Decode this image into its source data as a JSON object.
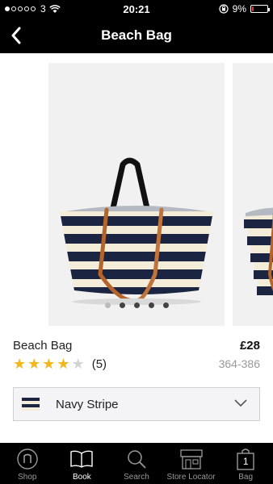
{
  "status_bar": {
    "carrier": "3",
    "time": "20:21",
    "battery": "9%",
    "battery_level": 0.09
  },
  "nav": {
    "title": "Beach Bag"
  },
  "gallery": {
    "page_count": 5,
    "current_page": 1
  },
  "product": {
    "name": "Beach Bag",
    "price": "£28",
    "rating": 4,
    "rating_max": 5,
    "review_count": "(5)",
    "code": "364-386"
  },
  "colour": {
    "selected": "Navy Stripe",
    "swatch_colors": [
      "#1b2440",
      "#f3ecd9",
      "#1b2440",
      "#f3ecd9"
    ]
  },
  "tabs": [
    {
      "label": "Shop",
      "icon": "shop-n-icon"
    },
    {
      "label": "Book",
      "icon": "book-icon",
      "active": true
    },
    {
      "label": "Search",
      "icon": "search-icon"
    },
    {
      "label": "Store Locator",
      "icon": "store-icon"
    },
    {
      "label": "Bag",
      "icon": "bag-icon",
      "badge": "1"
    }
  ],
  "colors": {
    "star": "#f4b71a",
    "bar_bg": "#000000",
    "navy": "#1b2440"
  }
}
